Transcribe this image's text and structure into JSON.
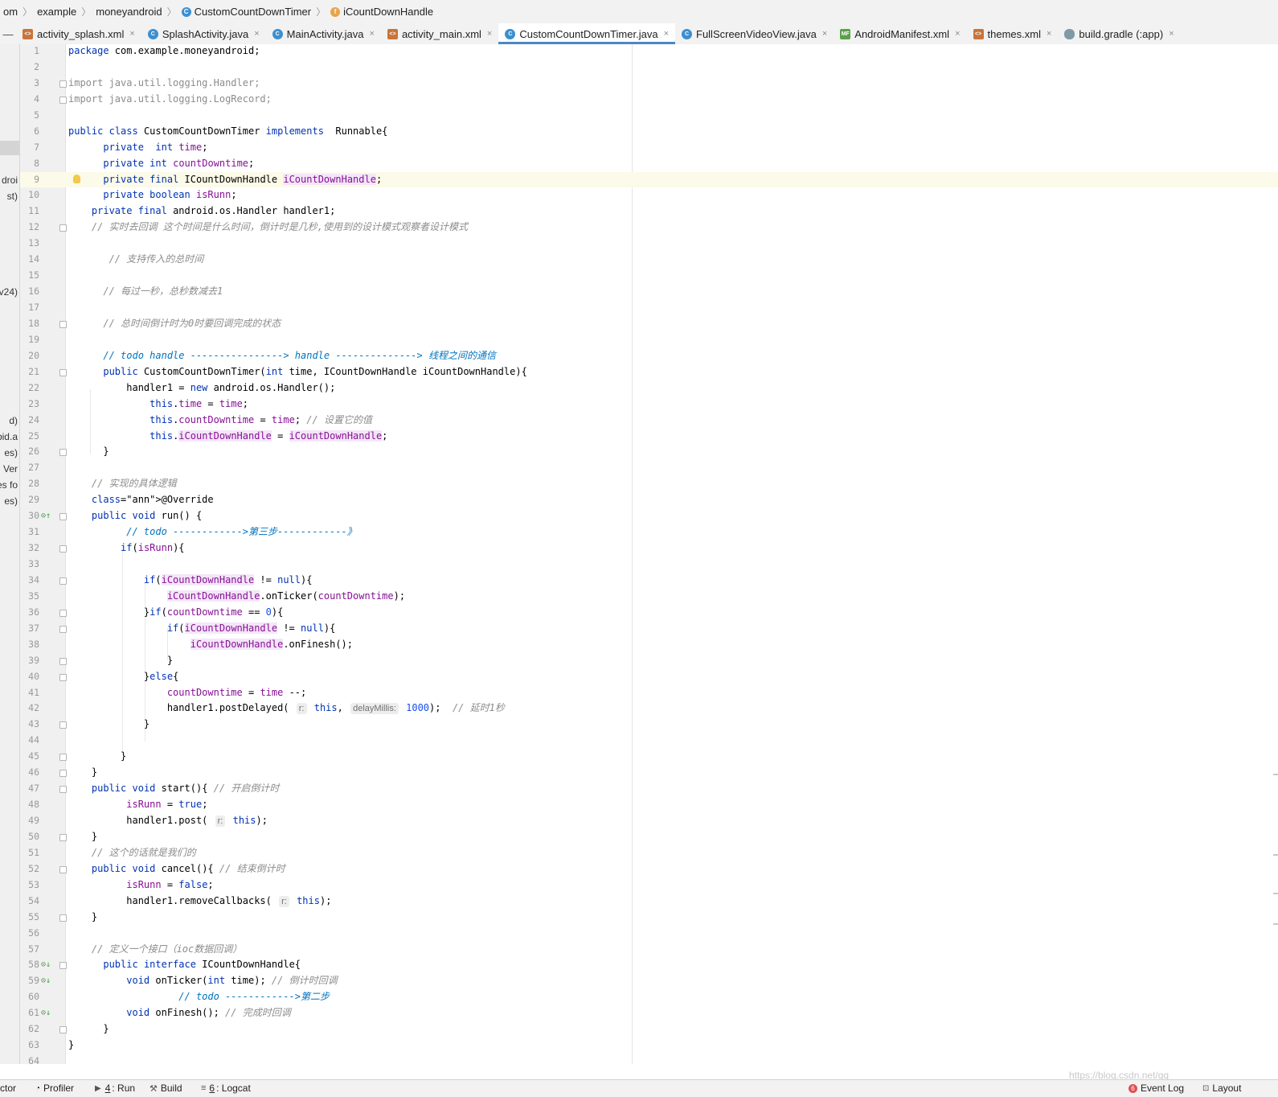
{
  "breadcrumb": [
    "om",
    "example",
    "moneyandroid",
    "CustomCountDownTimer",
    "iCountDownHandle"
  ],
  "tabs": [
    {
      "label": "activity_splash.xml",
      "icon": "xml-file-icon"
    },
    {
      "label": "SplashActivity.java",
      "icon": "java-class-icon"
    },
    {
      "label": "MainActivity.java",
      "icon": "java-class-icon"
    },
    {
      "label": "activity_main.xml",
      "icon": "xml-file-icon"
    },
    {
      "label": "CustomCountDownTimer.java",
      "icon": "java-class-icon",
      "active": true
    },
    {
      "label": "FullScreenVideoView.java",
      "icon": "java-class-icon"
    },
    {
      "label": "AndroidManifest.xml",
      "icon": "manifest-file-icon"
    },
    {
      "label": "themes.xml",
      "icon": "xml-file-icon"
    },
    {
      "label": "build.gradle (:app)",
      "icon": "gradle-file-icon"
    }
  ],
  "left_panel_fragments": [
    "droi",
    "st)",
    "v24)",
    "d)",
    "bid.a",
    "es)",
    "Ver",
    "es fo",
    "es)"
  ],
  "code_lines": [
    "package com.example.moneyandroid;",
    "",
    "import java.util.logging.Handler;",
    "import java.util.logging.LogRecord;",
    "",
    "public class CustomCountDownTimer implements  Runnable{",
    "      private  int time;",
    "      private int countDowntime;",
    "      private final ICountDownHandle iCountDownHandle;",
    "      private boolean isRunn;",
    "    private final android.os.Handler handler1;",
    "    // 实时去回调 这个时间是什么时间，倒计时是几秒,使用到的设计模式观察者设计模式",
    "",
    "       // 支持传入的总时间",
    "",
    "      // 每过一秒，总秒数减去1",
    "",
    "      // 总时间倒计时为0时要回调完成的状态",
    "",
    "      // todo handle ----------------> handle --------------> 线程之间的通信",
    "      public CustomCountDownTimer(int time, ICountDownHandle iCountDownHandle){",
    "          handler1 = new android.os.Handler();",
    "              this.time = time;",
    "              this.countDowntime = time; // 设置它的值",
    "              this.iCountDownHandle = iCountDownHandle;",
    "      }",
    "",
    "    // 实现的具体逻辑",
    "    @Override",
    "    public void run() {",
    "          // todo ------------>第三步------------》",
    "         if(isRunn){",
    "",
    "             if(iCountDownHandle != null){",
    "                 iCountDownHandle.onTicker(countDowntime);",
    "             }if(countDowntime == 0){",
    "                 if(iCountDownHandle != null){",
    "                     iCountDownHandle.onFinesh();",
    "                 }",
    "             }else{",
    "                 countDowntime = time --;",
    "                 handler1.postDelayed( r: this, delayMillis: 1000);  // 延时1秒",
    "             }",
    "",
    "         }",
    "    }",
    "    public void start(){ // 开启倒计时",
    "          isRunn = true;",
    "          handler1.post( r: this);",
    "    }",
    "    // 这个的话就是我们的",
    "    public void cancel(){ // 结束倒计时",
    "          isRunn = false;",
    "          handler1.removeCallbacks( r: this);",
    "    }",
    "",
    "    // 定义一个接口（ioc数据回调）",
    "      public interface ICountDownHandle{",
    "          void onTicker(int time); // 倒计时回调",
    "                   // todo ------------>第二步",
    "          void onFinesh(); // 完成时回调",
    "      }",
    "}",
    ""
  ],
  "status_bar": [
    {
      "label": "ctor"
    },
    {
      "label": "Profiler"
    },
    {
      "prefix": "4",
      "label": ": Run"
    },
    {
      "label": "Build"
    },
    {
      "prefix": "6",
      "label": ": Logcat"
    },
    {
      "label": "Event Log"
    },
    {
      "label": "Layout"
    }
  ],
  "watermark": "https://blog.csdn.net/qq_",
  "colors": {
    "keyword": "#0033b3",
    "field": "#871094",
    "comment": "#8c8c8c",
    "todo": "#0073bf",
    "number": "#1750eb",
    "annotation": "#9e880d",
    "active_tab_underline": "#4a88c7"
  }
}
